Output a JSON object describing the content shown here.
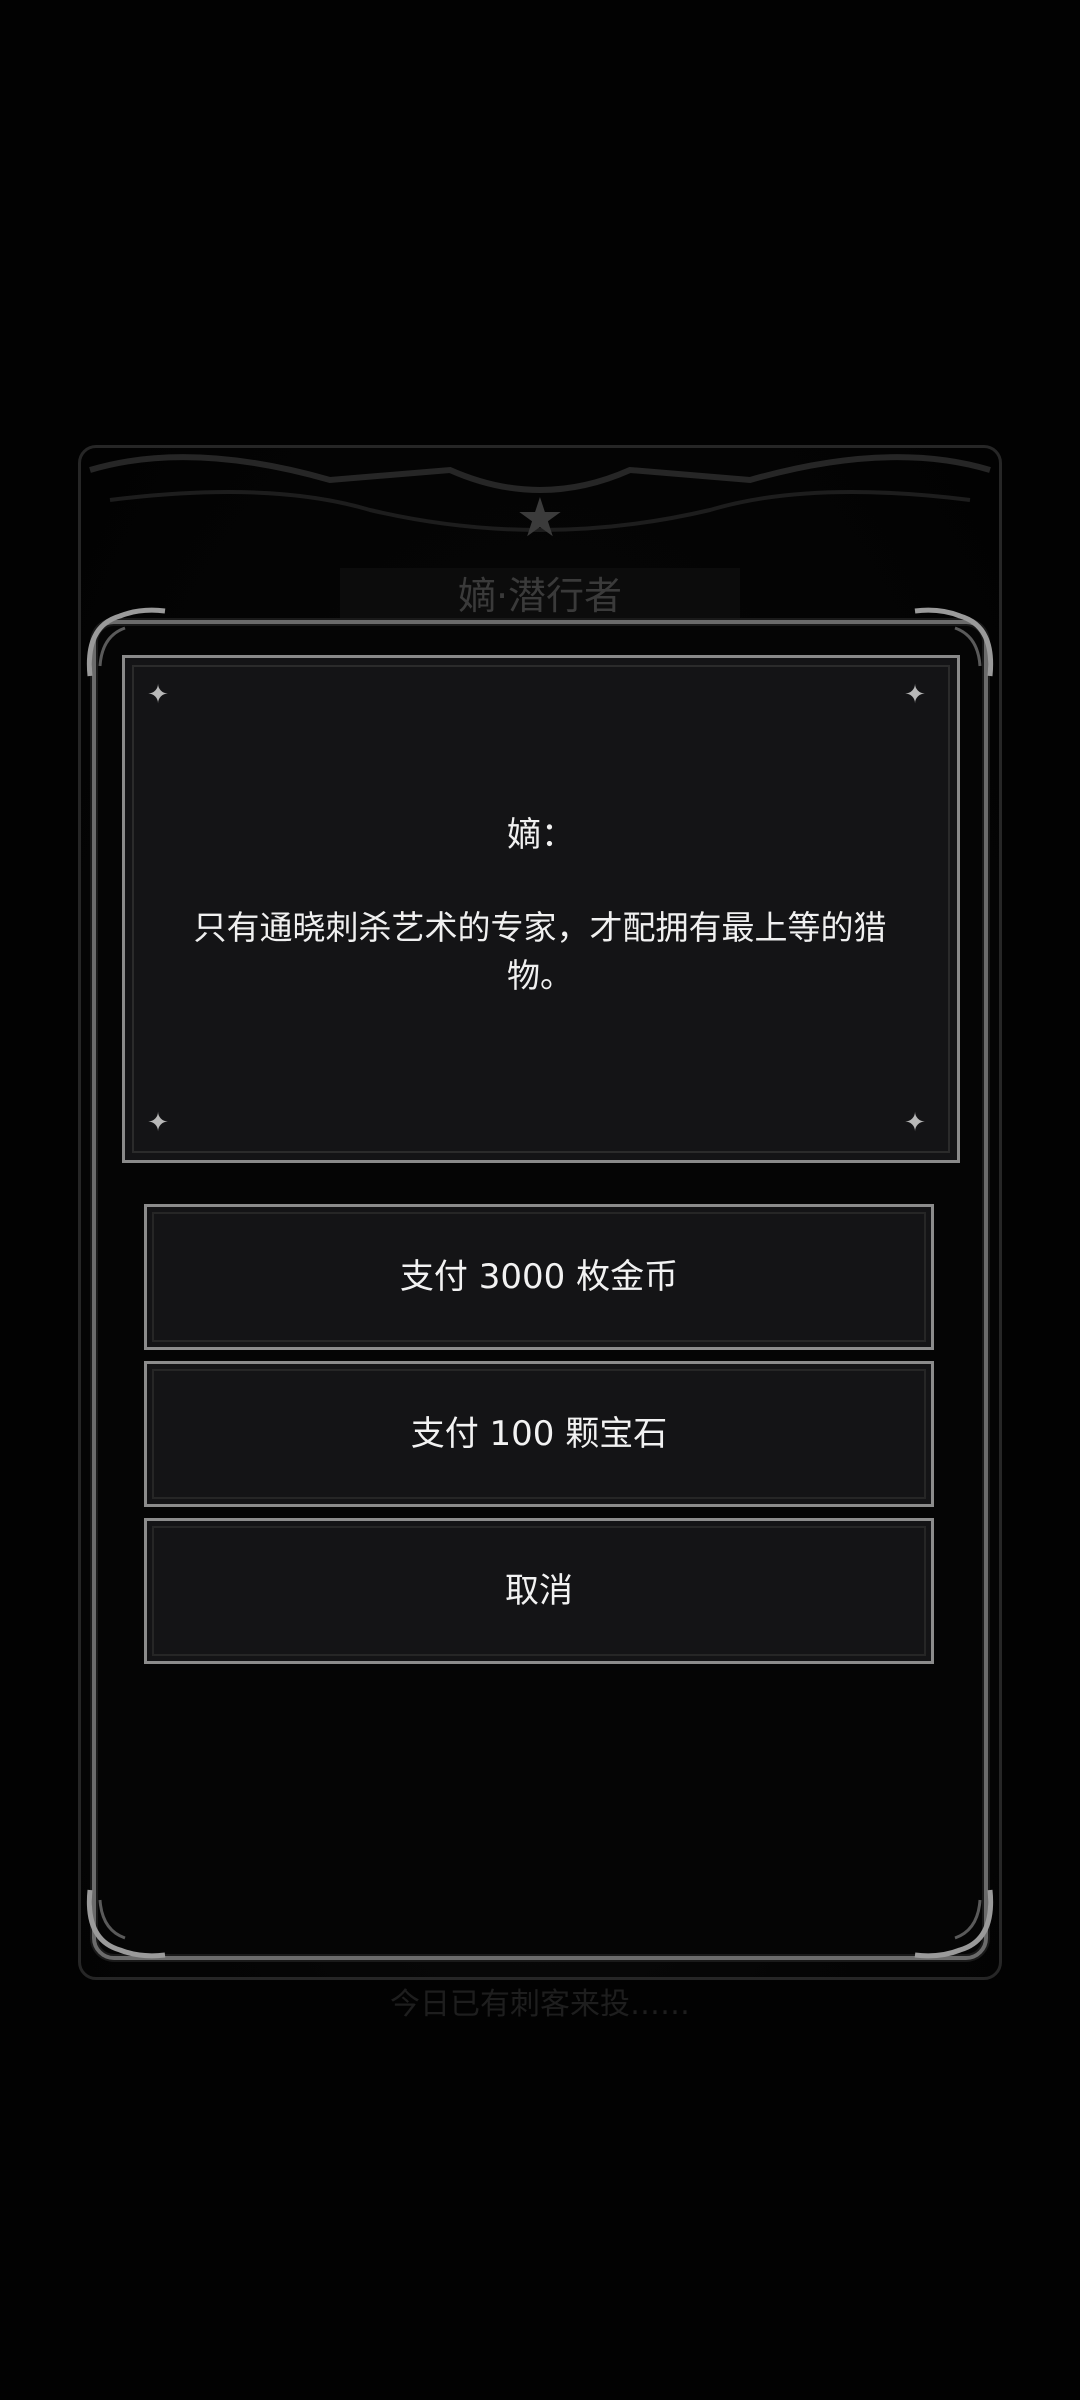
{
  "background": {
    "title": "嫡·潜行者",
    "bottom_text": "今日已有刺客来投……",
    "star_icon": "star-icon"
  },
  "dialog": {
    "speaker": "嫡：",
    "text": "只有通晓刺杀艺术的专家，才配拥有最上等的猎物。"
  },
  "options": [
    {
      "label": "支付 3000 枚金币"
    },
    {
      "label": "支付 100 颗宝石"
    },
    {
      "label": "取消"
    }
  ],
  "colors": {
    "background": "#020202",
    "panel": "#141416",
    "border": "#8c8c8c",
    "text": "#f0f0f0"
  }
}
